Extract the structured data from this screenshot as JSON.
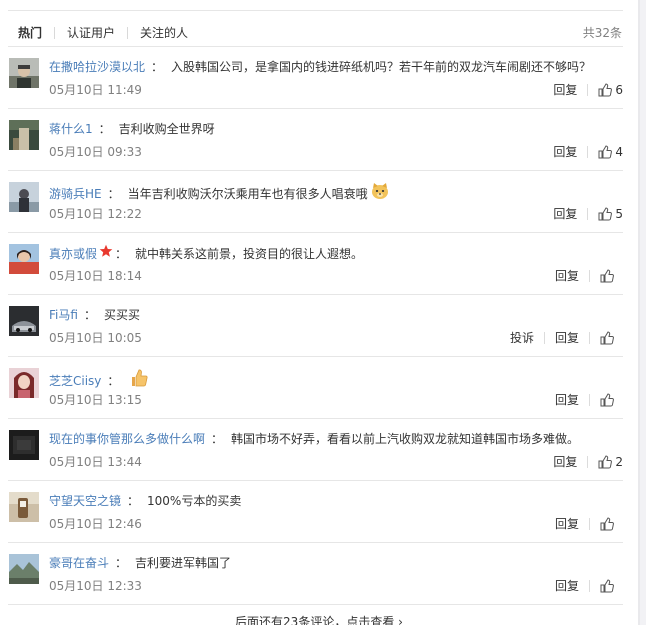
{
  "tabs": [
    {
      "label": "热门",
      "active": true
    },
    {
      "label": "认证用户",
      "active": false
    },
    {
      "label": "关注的人",
      "active": false
    }
  ],
  "total_count": "共32条",
  "report_label": "投诉",
  "reply_label": "回复",
  "comments": [
    {
      "user": "在撒哈拉沙漠以北",
      "text": "入股韩国公司，是拿国内的钱进碎纸机吗？若干年前的双龙汽车闹剧还不够吗？",
      "time": "05月10日 11:49",
      "likes": "6"
    },
    {
      "user": "蒋什么1",
      "text": "吉利收购全世界呀",
      "time": "05月10日 09:33",
      "likes": "4"
    },
    {
      "user": "游骑兵HE",
      "text": "当年吉利收购沃尔沃乘用车也有很多人唱衰哦",
      "time": "05月10日 12:22",
      "likes": "5",
      "emoji": "doge"
    },
    {
      "user": "真亦或假",
      "text": "就中韩关系这前景，投资目的很让人遐想。",
      "time": "05月10日 18:14",
      "likes": "",
      "badge": "star"
    },
    {
      "user": "Fi马fi",
      "text": "买买买",
      "time": "05月10日 10:05",
      "likes": "",
      "show_report": true
    },
    {
      "user": "芝芝Ciisy",
      "text": "",
      "time": "05月10日 13:15",
      "likes": "",
      "emoji": "thumbs-up"
    },
    {
      "user": "现在的事你管那么多做什么啊",
      "text": "韩国市场不好弄，看看以前上汽收购双龙就知道韩国市场多难做。",
      "time": "05月10日 13:44",
      "likes": "2"
    },
    {
      "user": "守望天空之镜",
      "text": "100%亏本的买卖",
      "time": "05月10日 12:46",
      "likes": ""
    },
    {
      "user": "豪哥在奋斗",
      "text": "吉利要进军韩国了",
      "time": "05月10日 12:33",
      "likes": ""
    }
  ],
  "more_text": "后面还有23条评论，点击查看 ›"
}
